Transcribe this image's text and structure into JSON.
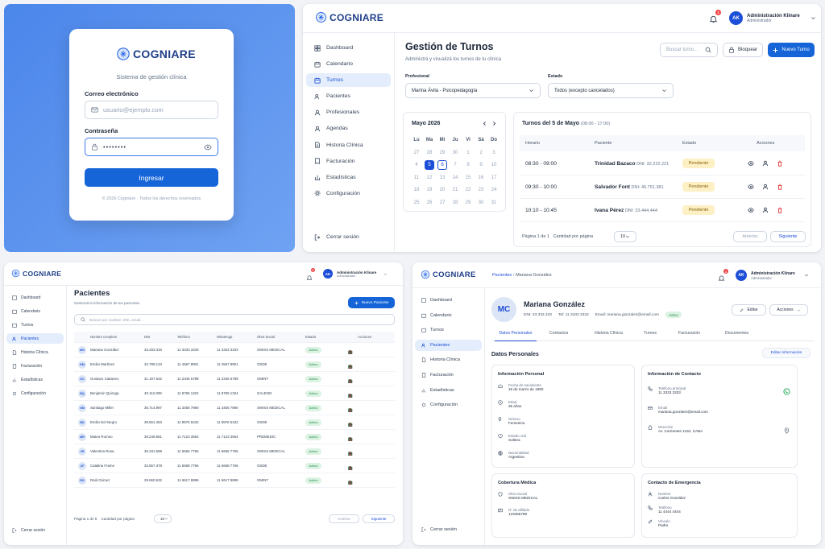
{
  "brand": {
    "name": "COGNIARE",
    "color": "#1f3f87"
  },
  "colors": {
    "primary": "#1565d8",
    "active_nav": "#e3edfb",
    "pending": "#fdf0c4",
    "active_status": "#dcf3e3",
    "danger": "#ef4444"
  },
  "login": {
    "subtitle": "Sistema de gestión clínica",
    "email_label": "Correo electrónico",
    "email_placeholder": "usuario@ejemplo.com",
    "password_label": "Contraseña",
    "password_value": "••••••••",
    "submit_label": "Ingresar",
    "footer": "© 2026 Cogniare · Todos los derechos reservados"
  },
  "user": {
    "initials": "AK",
    "name": "Administración Klinare",
    "role": "Administrador",
    "notifications": "1"
  },
  "nav": {
    "dashboard": "Dashboard",
    "calendario": "Calendario",
    "turnos": "Turnos",
    "pacientes": "Pacientes",
    "profesionales": "Profesionales",
    "agendas": "Agendas",
    "historia": "Historia Clínica",
    "facturacion": "Facturación",
    "estadisticas": "Estadísticas",
    "configuracion": "Configuración",
    "logout": "Cerrar sesión"
  },
  "turnos": {
    "title": "Gestión de Turnos",
    "subtitle": "Administrá y visualizá los turnos de tu clínica",
    "search_placeholder": "Buscar turno...",
    "block_label": "Bloquear",
    "new_label": "Nuevo Turno",
    "prof_label": "Profesional",
    "prof_value": "Marina Ávila - Psicopedagogía",
    "state_label": "Estado",
    "state_value": "Todos (excepto cancelados)",
    "calendar": {
      "month": "Mayo 2026",
      "dow": [
        "Lu",
        "Ma",
        "Mi",
        "Ju",
        "Vi",
        "Sá",
        "Do"
      ],
      "weeks": [
        [
          "27",
          "28",
          "29",
          "30",
          "1",
          "2",
          "3"
        ],
        [
          "4",
          "5",
          "6",
          "7",
          "8",
          "9",
          "10"
        ],
        [
          "11",
          "12",
          "13",
          "14",
          "15",
          "16",
          "17"
        ],
        [
          "18",
          "19",
          "20",
          "21",
          "22",
          "23",
          "24"
        ],
        [
          "25",
          "26",
          "27",
          "28",
          "29",
          "30",
          "31"
        ]
      ]
    },
    "day_title": "Turnos del 5 de Mayo",
    "day_hours": "(08:00 - 17:00)",
    "columns": [
      "Horario",
      "Paciente",
      "Estado",
      "Acciones"
    ],
    "rows": [
      {
        "time": "08:30 - 09:00",
        "name": "Trinidad Bazaco",
        "dni": "DNI: 32.222.221",
        "status": "Pendiente"
      },
      {
        "time": "09:30 - 10:00",
        "name": "Salvador Font",
        "dni": "DNI: 45.751.381",
        "status": "Pendiente"
      },
      {
        "time": "10:10 - 10:45",
        "name": "Ivana Pérez",
        "dni": "DNI: 33.444.444",
        "status": "Pendiente"
      }
    ],
    "pager": {
      "page_label": "Página",
      "page": "1 de 1",
      "per_page_label": "Cantidad por página",
      "per_page": "10",
      "prev": "Anterior",
      "next": "Siguiente"
    }
  },
  "pacientes": {
    "title": "Pacientes",
    "subtitle": "Gestioná la información de tus pacientes",
    "new_label": "Nuevo Paciente",
    "search_placeholder": "Buscar por nombre, DNI, email...",
    "columns": [
      "Nombre completo",
      "DNI",
      "Teléfono",
      "WhatsApp",
      "Obra Social",
      "Estado",
      "Acciones"
    ],
    "rows": [
      {
        "ini": "MG",
        "name": "Mariana González",
        "dni": "33.333.333",
        "tel": "11 3333 3333",
        "wa": "11 3333 3333",
        "os": "SWISS MEDICAL",
        "st": "Activo"
      },
      {
        "ini": "EM",
        "name": "Emilio Martínez",
        "dni": "34.789.123",
        "tel": "11 4567 8901",
        "wa": "11 4567 8901",
        "os": "OSDE",
        "st": "Activo"
      },
      {
        "ini": "GC",
        "name": "Gustavo Cattaneo",
        "dni": "31.157.632",
        "tel": "11 2345 6789",
        "wa": "11 2345 6789",
        "os": "OMINT",
        "st": "Activo"
      },
      {
        "ini": "BQ",
        "name": "Benjamín Quiroga",
        "dni": "40.112.839",
        "tel": "11 8765 1324",
        "wa": "11 8765 1324",
        "os": "GALENO",
        "st": "Activo"
      },
      {
        "ini": "SM",
        "name": "Santiago Miller",
        "dni": "36.714.987",
        "tel": "11 3456 7890",
        "wa": "11 3456 7890",
        "os": "SWISS MEDICAL",
        "st": "Activo"
      },
      {
        "ini": "BD",
        "name": "Emilio Del Negro",
        "dni": "38.561.453",
        "tel": "11 9876 5432",
        "wa": "11 9876 5432",
        "os": "OSDE",
        "st": "Activo"
      },
      {
        "ini": "MR",
        "name": "Mateo Romeo",
        "dni": "39.246.851",
        "tel": "11 7123 3654",
        "wa": "11 7123 3654",
        "os": "PREMEDIC",
        "st": "Activo"
      },
      {
        "ini": "VR",
        "name": "Valentina Rosa",
        "dni": "35.231.589",
        "tel": "11 6666 7766",
        "wa": "11 6666 7766",
        "os": "SWISS MEDICAL",
        "st": "Activo"
      },
      {
        "ini": "CF",
        "name": "Catalina Frame",
        "dni": "32.557.378",
        "tel": "11 6668 7766",
        "wa": "11 6668 7766",
        "os": "OSDE",
        "st": "Activo"
      },
      {
        "ini": "RG",
        "name": "Raúl Gómez",
        "dni": "29.650.632",
        "tel": "11 6617 8899",
        "wa": "11 6617 8899",
        "os": "OMINT",
        "st": "Activo"
      }
    ],
    "pager": {
      "page_label": "Página",
      "page": "1 de 5",
      "per_page_label": "Cantidad por página",
      "per_page": "10",
      "prev": "Anterior",
      "next": "Siguiente"
    }
  },
  "detalle": {
    "crumb_root": "Pacientes",
    "crumb_sep": "›",
    "crumb_current": "Mariana González",
    "initials": "MC",
    "name": "Mariana González",
    "dni": "DNI: 33.333.333",
    "tel": "Tel: 11 3333 3333",
    "email": "Email: mariana.gonzalez@email.com",
    "status": "Activo",
    "edit_label": "Editar",
    "actions_label": "Acciones",
    "tabs": [
      "Datos Personales",
      "Contactos",
      "Historia Clínica",
      "Turnos",
      "Facturación",
      "Documentos"
    ],
    "section_title": "Datos Personales",
    "edit_info": "Editar información",
    "personal": {
      "title": "Información Personal",
      "items": [
        {
          "k": "Fecha de nacimiento",
          "v": "15 de marzo de 1990"
        },
        {
          "k": "Edad",
          "v": "35 años"
        },
        {
          "k": "Género",
          "v": "Femenino"
        },
        {
          "k": "Estado civil",
          "v": "Soltera"
        },
        {
          "k": "Nacionalidad",
          "v": "Argentina"
        }
      ]
    },
    "contact": {
      "title": "Información de Contacto",
      "items": [
        {
          "k": "Teléfono principal",
          "v": "11 3333 3333"
        },
        {
          "k": "Email",
          "v": "mariana.gonzalez@email.com"
        },
        {
          "k": "Dirección",
          "v": "Av. Corrientes 1234, CABA"
        }
      ]
    },
    "coverage": {
      "title": "Cobertura Médica",
      "items": [
        {
          "k": "Obra Social",
          "v": "SWISS MEDICAL"
        },
        {
          "k": "N° de afiliado",
          "v": "123456789"
        }
      ]
    },
    "emergency": {
      "title": "Contacto de Emergencia",
      "items": [
        {
          "k": "Nombre",
          "v": "Carlos González"
        },
        {
          "k": "Teléfono",
          "v": "11 4444 4444"
        },
        {
          "k": "Vínculo",
          "v": "Padre"
        }
      ]
    }
  }
}
